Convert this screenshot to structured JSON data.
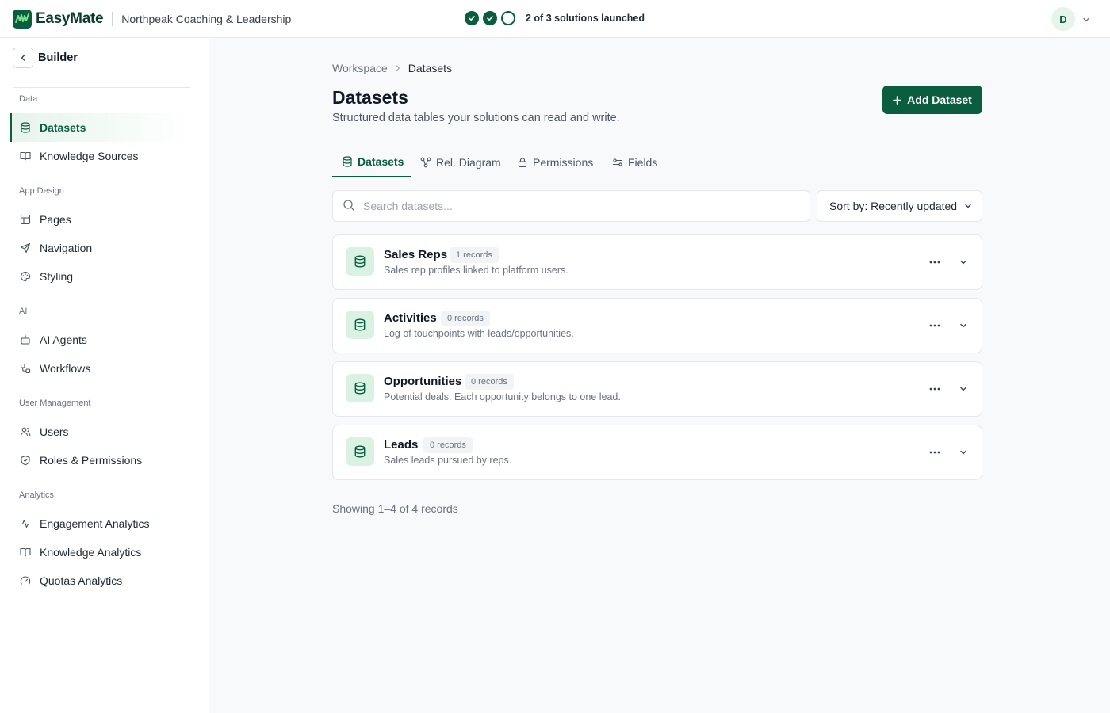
{
  "app": {
    "brand": "EasyMate",
    "org": "Northpeak Coaching & Leadership",
    "progress_text": "2 of 3 solutions launched",
    "steps": [
      "done",
      "done",
      "todo"
    ],
    "avatar": "D",
    "accent": "#0b5d3f"
  },
  "sidebar": {
    "title": "Builder",
    "sections": [
      {
        "title": "Data"
      },
      {
        "title": "App Design"
      },
      {
        "title": "AI"
      },
      {
        "title": "User Management"
      },
      {
        "title": "Analytics"
      }
    ],
    "items": [
      {
        "label": "Datasets",
        "icon": "database-icon",
        "active": true
      },
      {
        "label": "Knowledge Sources",
        "icon": "book-icon"
      },
      {
        "label": "Pages",
        "icon": "layout-icon"
      },
      {
        "label": "Navigation",
        "icon": "send-icon"
      },
      {
        "label": "Styling",
        "icon": "palette-icon"
      },
      {
        "label": "AI Agents",
        "icon": "bot-icon"
      },
      {
        "label": "Workflows",
        "icon": "workflow-icon"
      },
      {
        "label": "Users",
        "icon": "users-icon"
      },
      {
        "label": "Roles & Permissions",
        "icon": "shield-icon"
      },
      {
        "label": "Engagement Analytics",
        "icon": "activity-icon"
      },
      {
        "label": "Knowledge Analytics",
        "icon": "book-icon"
      },
      {
        "label": "Quotas Analytics",
        "icon": "gauge-icon"
      }
    ]
  },
  "main": {
    "breadcrumb": [
      "Workspace",
      "Datasets"
    ],
    "title": "Datasets",
    "subtitle": "Structured data tables your solutions can read and write.",
    "add_button": "Add Dataset",
    "tabs": [
      {
        "label": "Datasets",
        "icon": "database-icon",
        "active": true
      },
      {
        "label": "Rel. Diagram",
        "icon": "network-icon"
      },
      {
        "label": "Permissions",
        "icon": "lock-icon"
      },
      {
        "label": "Fields",
        "icon": "fields-icon"
      }
    ],
    "search_placeholder": "Search datasets...",
    "sort_label": "Sort by: Recently updated",
    "datasets": [
      {
        "name": "Sales Reps",
        "badge": "1 records",
        "description": "Sales rep profiles linked to platform users."
      },
      {
        "name": "Activities",
        "badge": "0 records",
        "description": "Log of touchpoints with leads/opportunities."
      },
      {
        "name": "Opportunities",
        "badge": "0 records",
        "description": "Potential deals. Each opportunity belongs to one lead."
      },
      {
        "name": "Leads",
        "badge": "0 records",
        "description": "Sales leads pursued by reps."
      }
    ],
    "showing": "Showing 1–4 of 4 records"
  }
}
